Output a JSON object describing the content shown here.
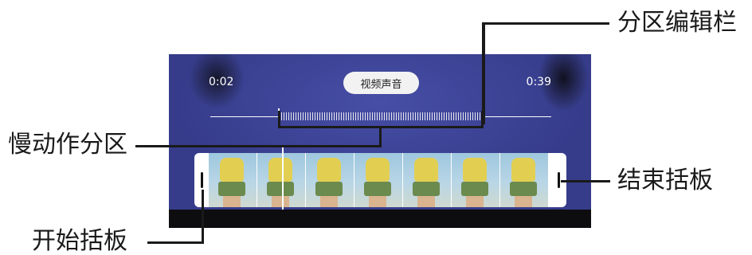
{
  "player": {
    "time_start": "0:02",
    "time_end": "0:39",
    "audio_button_label": "视频声音"
  },
  "callouts": {
    "section_edit_bar": "分区编辑栏",
    "slow_motion_section": "慢动作分区",
    "end_handle": "结束括板",
    "start_handle": "开始括板"
  },
  "filmstrip": {
    "frame_count": 7
  },
  "colors": {
    "video_background": "#3b4296",
    "annotation_text": "#1a1a1a"
  }
}
